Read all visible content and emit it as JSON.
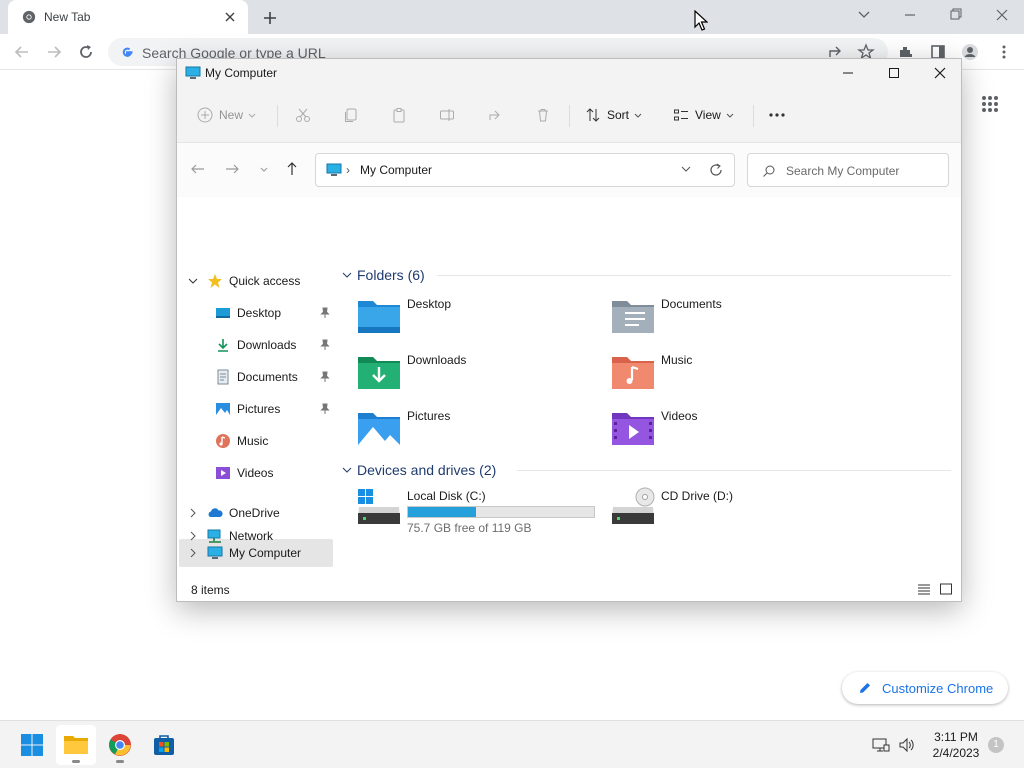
{
  "browser": {
    "tab_title": "New Tab",
    "omnibox_placeholder": "Search Google or type a URL",
    "customize_label": "Customize Chrome"
  },
  "explorer": {
    "window_title": "My Computer",
    "commands": {
      "new_label": "New",
      "sort_label": "Sort",
      "view_label": "View"
    },
    "address": {
      "current": "My Computer",
      "search_placeholder": "Search My Computer"
    },
    "nav": {
      "quick_access": "Quick access",
      "pinned": [
        {
          "label": "Desktop",
          "icon": "desktop-icon"
        },
        {
          "label": "Downloads",
          "icon": "download-icon"
        },
        {
          "label": "Documents",
          "icon": "document-icon"
        },
        {
          "label": "Pictures",
          "icon": "pictures-icon"
        },
        {
          "label": "Music",
          "icon": "music-icon"
        },
        {
          "label": "Videos",
          "icon": "videos-icon"
        }
      ],
      "onedrive": "OneDrive",
      "my_computer": "My Computer",
      "network": "Network"
    },
    "folders_heading": "Folders (6)",
    "folders": [
      {
        "name": "Desktop",
        "icon": "desktop-folder-icon"
      },
      {
        "name": "Documents",
        "icon": "documents-folder-icon"
      },
      {
        "name": "Downloads",
        "icon": "downloads-folder-icon"
      },
      {
        "name": "Music",
        "icon": "music-folder-icon"
      },
      {
        "name": "Pictures",
        "icon": "pictures-folder-icon"
      },
      {
        "name": "Videos",
        "icon": "videos-folder-icon"
      }
    ],
    "drives_heading": "Devices and drives (2)",
    "drives": [
      {
        "name": "Local Disk (C:)",
        "free_text": "75.7 GB free of 119 GB",
        "used_fraction": 0.364
      },
      {
        "name": "CD Drive (D:)"
      }
    ],
    "status_count": "8 items"
  },
  "taskbar": {
    "time": "3:11 PM",
    "date": "2/4/2023",
    "notification_count": "1"
  },
  "colors": {
    "accent": "#26a0da",
    "chrome_blue": "#1a73e8",
    "selection": "#e5e5e5"
  }
}
